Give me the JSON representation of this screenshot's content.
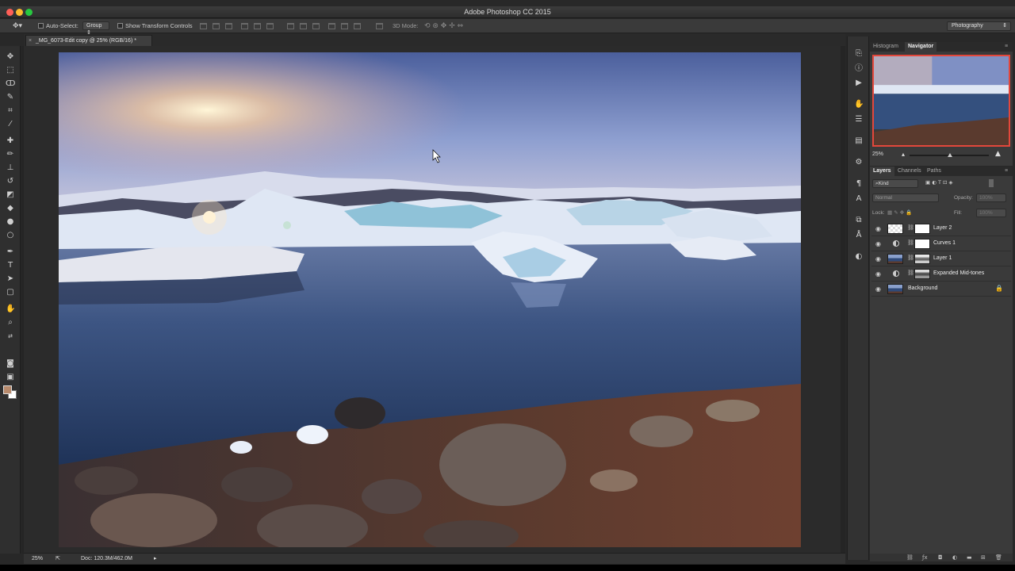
{
  "app": {
    "title": "Adobe Photoshop CC 2015"
  },
  "options_bar": {
    "auto_select_label": "Auto-Select:",
    "auto_select_value": "Group",
    "transform_controls_label": "Show Transform Controls",
    "mode_3d_label": "3D Mode:",
    "workspace": "Photography"
  },
  "document": {
    "tab_title": "_MG_6073-Edit copy @ 25% (RGB/16) *",
    "tab_close": "×"
  },
  "status": {
    "zoom": "25%",
    "doc_info": "Doc: 120.3M/462.0M"
  },
  "navigator": {
    "tabs": [
      "Histogram",
      "Navigator"
    ],
    "active_tab": "Navigator",
    "zoom": "25%"
  },
  "layers_panel": {
    "tabs": [
      "Layers",
      "Channels",
      "Paths"
    ],
    "active_tab": "Layers",
    "filter_kind": "Kind",
    "blend_mode": "Normal",
    "opacity_label": "Opacity:",
    "opacity_value": "100%",
    "lock_label": "Lock:",
    "fill_label": "Fill:",
    "fill_value": "100%",
    "layers": [
      {
        "name": "Layer 2",
        "type": "pixel-mask",
        "locked": false
      },
      {
        "name": "Curves 1",
        "type": "adjustment",
        "locked": false
      },
      {
        "name": "Layer 1",
        "type": "pixel-mask",
        "locked": false
      },
      {
        "name": "Expanded Mid-tones",
        "type": "adjustment",
        "locked": false
      },
      {
        "name": "Background",
        "type": "background",
        "locked": true
      }
    ]
  },
  "colors": {
    "foreground": "#b88a6c",
    "background": "#ffffff",
    "navigator_box": "#e3473b"
  }
}
